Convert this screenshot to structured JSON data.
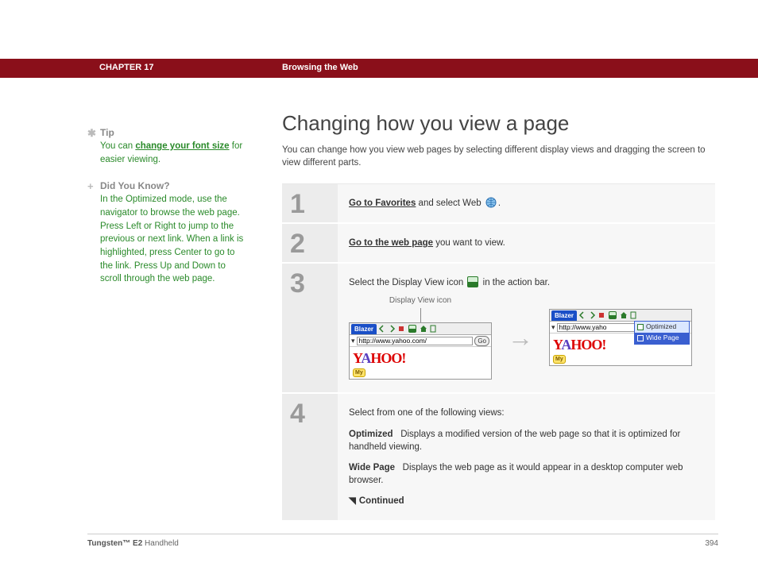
{
  "header": {
    "chapter": "CHAPTER 17",
    "section": "Browsing the Web"
  },
  "sidebar": {
    "tip": {
      "head": "Tip",
      "pre": "You can ",
      "link": "change your font size",
      "post": " for easier viewing."
    },
    "dyk": {
      "head": "Did You Know?",
      "body": "In the Optimized mode, use the navigator to browse the web page. Press Left or Right to jump to the previous or next link. When a link is highlighted, press Center to go to the link. Press Up and Down to scroll through the web page."
    }
  },
  "main": {
    "title": "Changing how you view a page",
    "intro": "You can change how you view web pages by selecting different display views and dragging the screen to view different parts.",
    "steps": {
      "s1": {
        "num": "1",
        "link": "Go to Favorites",
        "post": " and select Web "
      },
      "s2": {
        "num": "2",
        "link": "Go to the web page",
        "post": " you want to view."
      },
      "s3": {
        "num": "3",
        "pre": "Select the Display View icon ",
        "post": "  in the action bar.",
        "shotLabel": "Display View icon",
        "tab": "Blazer",
        "url1": "http://www.yahoo.com/",
        "url2": "http://www.yaho",
        "go": "Go",
        "logo": "YAHOO!",
        "my": "My",
        "opt": "Optimized",
        "wide": "Wide Page"
      },
      "s4": {
        "num": "4",
        "lead": "Select from one of the following views:",
        "optLabel": "Optimized",
        "optText": "Displays a modified version of the web page so that it is optimized for handheld viewing.",
        "wideLabel": "Wide Page",
        "wideText": "Displays the web page as it would appear in a desktop computer web browser.",
        "continued": "Continued"
      }
    }
  },
  "footer": {
    "product_bold": "Tungsten™ E2",
    "product_rest": " Handheld",
    "page": "394"
  }
}
